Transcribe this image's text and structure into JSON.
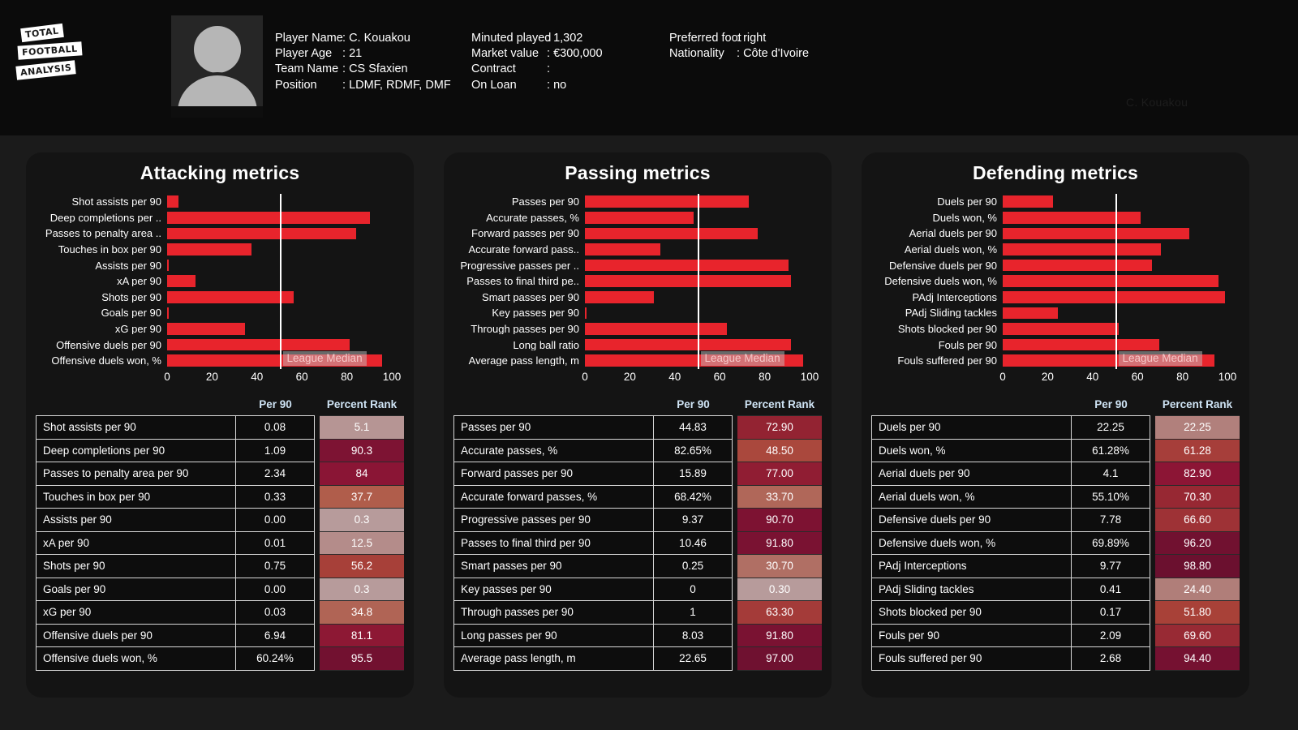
{
  "brand": {
    "line1": "TOTAL",
    "line2": "FOOTBALL",
    "line3": "ANALYSIS"
  },
  "header": {
    "watermark": "C. Kouakou",
    "avatar_icon": "person-placeholder-icon",
    "col1": [
      {
        "key": "Player Name",
        "sep": ":",
        "value": "C. Kouakou"
      },
      {
        "key": "Player Age",
        "sep": ":",
        "value": "21"
      },
      {
        "key": "Team Name",
        "sep": ":",
        "value": "CS Sfaxien"
      },
      {
        "key": "Position",
        "sep": ":",
        "value": "LDMF, RDMF, DMF"
      }
    ],
    "col2": [
      {
        "key": "Minuted played",
        "sep": ":",
        "value": "1,302"
      },
      {
        "key": "Market value",
        "sep": ":",
        "value": "€300,000"
      },
      {
        "key": "Contract",
        "sep": ":",
        "value": ""
      },
      {
        "key": "On Loan",
        "sep": ":",
        "value": "no"
      }
    ],
    "col3": [
      {
        "key": "Preferred foot",
        "sep": ":",
        "value": "right"
      },
      {
        "key": "Nationality",
        "sep": ":",
        "value": "Côte d'Ivoire"
      }
    ]
  },
  "table_headers": {
    "metric": "",
    "per90": "Per 90",
    "rank": "Percent Rank"
  },
  "median_label": "League Median",
  "axis_ticks": [
    "0",
    "20",
    "40",
    "60",
    "80",
    "100"
  ],
  "colors": {
    "bar": "#e8242c",
    "median_line": "#ffffff",
    "panel_bg": "#141414",
    "page_bg": "#1b1b1b",
    "header_bg": "#0b0b0b",
    "header_text_accent": "#cfe4f5"
  },
  "chart_data": [
    {
      "type": "bar",
      "title": "Attacking metrics",
      "xlabel": "",
      "ylabel": "",
      "xlim": [
        0,
        100
      ],
      "grid": false,
      "orientation": "horizontal",
      "median_value": 50,
      "annotations": [
        "League Median"
      ],
      "categories": [
        "Shot assists per 90",
        "Deep completions per ..",
        "Passes to penalty area ..",
        "Touches in box per 90",
        "Assists per 90",
        "xA per 90",
        "Shots per 90",
        "Goals per 90",
        "xG per 90",
        "Offensive duels per 90",
        "Offensive duels won, %"
      ],
      "values": [
        5.1,
        90.3,
        84,
        37.7,
        0.3,
        12.5,
        56.2,
        0.3,
        34.8,
        81.1,
        95.5
      ],
      "table": {
        "columns": [
          "",
          "Per 90",
          "Percent Rank"
        ],
        "rows": [
          {
            "metric": "Shot assists per 90",
            "per90": "0.08",
            "rank": "5.1",
            "rank_value": 5.1
          },
          {
            "metric": "Deep completions per 90",
            "per90": "1.09",
            "rank": "90.3",
            "rank_value": 90.3
          },
          {
            "metric": "Passes to penalty area per 90",
            "per90": "2.34",
            "rank": "84",
            "rank_value": 84
          },
          {
            "metric": "Touches in box per 90",
            "per90": "0.33",
            "rank": "37.7",
            "rank_value": 37.7
          },
          {
            "metric": "Assists per 90",
            "per90": "0.00",
            "rank": "0.3",
            "rank_value": 0.3
          },
          {
            "metric": "xA per 90",
            "per90": "0.01",
            "rank": "12.5",
            "rank_value": 12.5
          },
          {
            "metric": "Shots per 90",
            "per90": "0.75",
            "rank": "56.2",
            "rank_value": 56.2
          },
          {
            "metric": "Goals per 90",
            "per90": "0.00",
            "rank": "0.3",
            "rank_value": 0.3
          },
          {
            "metric": "xG per 90",
            "per90": "0.03",
            "rank": "34.8",
            "rank_value": 34.8
          },
          {
            "metric": "Offensive duels per 90",
            "per90": "6.94",
            "rank": "81.1",
            "rank_value": 81.1
          },
          {
            "metric": "Offensive duels won, %",
            "per90": "60.24%",
            "rank": "95.5",
            "rank_value": 95.5
          }
        ]
      }
    },
    {
      "type": "bar",
      "title": "Passing metrics",
      "xlabel": "",
      "ylabel": "",
      "xlim": [
        0,
        100
      ],
      "grid": false,
      "orientation": "horizontal",
      "median_value": 50,
      "annotations": [
        "League Median"
      ],
      "categories": [
        "Passes per 90",
        "Accurate passes, %",
        "Forward passes per 90",
        "Accurate forward pass..",
        "Progressive passes per ..",
        "Passes to final third pe..",
        "Smart passes per 90",
        "Key passes per 90",
        "Through passes per 90",
        "Long ball ratio",
        "Average pass length, m"
      ],
      "values": [
        72.9,
        48.5,
        77.0,
        33.7,
        90.7,
        91.8,
        30.7,
        0.3,
        63.3,
        91.8,
        97.0
      ],
      "table": {
        "columns": [
          "",
          "Per 90",
          "Percent Rank"
        ],
        "rows": [
          {
            "metric": "Passes per 90",
            "per90": "44.83",
            "rank": "72.90",
            "rank_value": 72.9
          },
          {
            "metric": "Accurate passes, %",
            "per90": "82.65%",
            "rank": "48.50",
            "rank_value": 48.5
          },
          {
            "metric": "Forward passes per 90",
            "per90": "15.89",
            "rank": "77.00",
            "rank_value": 77.0
          },
          {
            "metric": "Accurate forward passes, %",
            "per90": "68.42%",
            "rank": "33.70",
            "rank_value": 33.7
          },
          {
            "metric": "Progressive passes per 90",
            "per90": "9.37",
            "rank": "90.70",
            "rank_value": 90.7
          },
          {
            "metric": "Passes to final third per 90",
            "per90": "10.46",
            "rank": "91.80",
            "rank_value": 91.8
          },
          {
            "metric": "Smart passes per 90",
            "per90": "0.25",
            "rank": "30.70",
            "rank_value": 30.7
          },
          {
            "metric": "Key passes per 90",
            "per90": "0",
            "rank": "0.30",
            "rank_value": 0.3
          },
          {
            "metric": "Through passes per 90",
            "per90": "1",
            "rank": "63.30",
            "rank_value": 63.3
          },
          {
            "metric": "Long passes per 90",
            "per90": "8.03",
            "rank": "91.80",
            "rank_value": 91.8
          },
          {
            "metric": "Average pass length, m",
            "per90": "22.65",
            "rank": "97.00",
            "rank_value": 97.0
          }
        ]
      }
    },
    {
      "type": "bar",
      "title": "Defending metrics",
      "xlabel": "",
      "ylabel": "",
      "xlim": [
        0,
        100
      ],
      "grid": false,
      "orientation": "horizontal",
      "median_value": 50,
      "annotations": [
        "League Median"
      ],
      "categories": [
        "Duels per 90",
        "Duels won, %",
        "Aerial duels per 90",
        "Aerial duels won, %",
        "Defensive duels per 90",
        "Defensive duels won, %",
        "PAdj Interceptions",
        "PAdj Sliding tackles",
        "Shots blocked per 90",
        "Fouls per 90",
        "Fouls suffered per 90"
      ],
      "values": [
        22.25,
        61.28,
        82.9,
        70.3,
        66.6,
        96.2,
        98.8,
        24.4,
        51.8,
        69.6,
        94.4
      ],
      "table": {
        "columns": [
          "",
          "Per 90",
          "Percent Rank"
        ],
        "rows": [
          {
            "metric": "Duels per 90",
            "per90": "22.25",
            "rank": "22.25",
            "rank_value": 22.25
          },
          {
            "metric": "Duels won, %",
            "per90": "61.28%",
            "rank": "61.28",
            "rank_value": 61.28
          },
          {
            "metric": "Aerial duels per 90",
            "per90": "4.1",
            "rank": "82.90",
            "rank_value": 82.9
          },
          {
            "metric": "Aerial duels won, %",
            "per90": "55.10%",
            "rank": "70.30",
            "rank_value": 70.3
          },
          {
            "metric": "Defensive duels per 90",
            "per90": "7.78",
            "rank": "66.60",
            "rank_value": 66.6
          },
          {
            "metric": "Defensive duels won, %",
            "per90": "69.89%",
            "rank": "96.20",
            "rank_value": 96.2
          },
          {
            "metric": "PAdj Interceptions",
            "per90": "9.77",
            "rank": "98.80",
            "rank_value": 98.8
          },
          {
            "metric": "PAdj Sliding tackles",
            "per90": "0.41",
            "rank": "24.40",
            "rank_value": 24.4
          },
          {
            "metric": "Shots blocked per 90",
            "per90": "0.17",
            "rank": "51.80",
            "rank_value": 51.8
          },
          {
            "metric": "Fouls per 90",
            "per90": "2.09",
            "rank": "69.60",
            "rank_value": 69.6
          },
          {
            "metric": "Fouls suffered per 90",
            "per90": "2.68",
            "rank": "94.40",
            "rank_value": 94.4
          }
        ]
      }
    }
  ]
}
